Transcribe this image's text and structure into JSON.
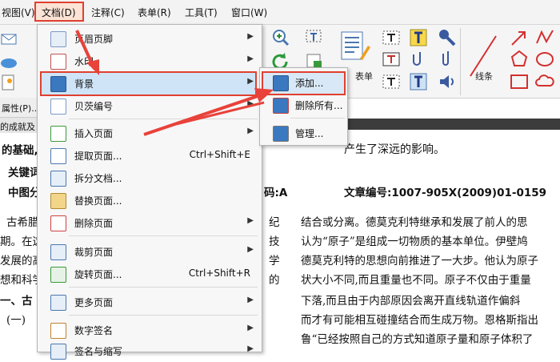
{
  "menubar": {
    "items": [
      {
        "label": "视图(V)"
      },
      {
        "label": "文档(D)"
      },
      {
        "label": "注释(C)"
      },
      {
        "label": "表单(R)"
      },
      {
        "label": "工具(T)"
      },
      {
        "label": "窗口(W)"
      }
    ]
  },
  "toolbar": {
    "props_label": "属性(P)...",
    "form_label": "表单",
    "line_label": "线条"
  },
  "document": {
    "lines": [
      "的基础,",
      "产生了深远的影响。",
      "关键词",
      "中图分",
      "码:A",
      "文章编号:1007-905X(2009)01-0159",
      "古希腊",
      "纪",
      "结合或分离。德莫克利特继承和发展了前人的思",
      "期。在这",
      "技",
      "认为“原子”是组成一切物质的基本单位。伊壁鸠",
      "发展的高",
      "学",
      "德莫克利特的思想向前推进了一大步。他认为原子",
      "想和科学",
      "的",
      "状大小不同,而且重量也不同。原子不仅由于重量",
      "一、古",
      "下落,而且由于内部原因会离开直线轨道作偏斜",
      "(一)",
      "而才有可能相互碰撞结合而生成万物。恩格斯指出",
      "鲁“已经按照自己的方式知道原子量和原子体积了",
      "的成就及"
    ]
  },
  "dropdown": {
    "items": [
      {
        "label": "页眉页脚",
        "shortcut": "",
        "submenu": true
      },
      {
        "label": "水印",
        "shortcut": "",
        "submenu": true
      },
      {
        "label": "背景",
        "shortcut": "",
        "submenu": true
      },
      {
        "label": "贝茨编号",
        "shortcut": "",
        "submenu": true
      },
      {
        "label": "插入页面",
        "shortcut": "",
        "submenu": true
      },
      {
        "label": "提取页面...",
        "shortcut": "Ctrl+Shift+E",
        "submenu": false
      },
      {
        "label": "拆分文档...",
        "shortcut": "",
        "submenu": false
      },
      {
        "label": "替换页面...",
        "shortcut": "",
        "submenu": false
      },
      {
        "label": "删除页面",
        "shortcut": "",
        "submenu": true
      },
      {
        "label": "裁剪页面",
        "shortcut": "",
        "submenu": true
      },
      {
        "label": "旋转页面...",
        "shortcut": "Ctrl+Shift+R",
        "submenu": false
      },
      {
        "label": "更多页面",
        "shortcut": "",
        "submenu": true
      },
      {
        "label": "数字签名",
        "shortcut": "",
        "submenu": true
      },
      {
        "label": "签名与缩写",
        "shortcut": "",
        "submenu": true
      }
    ]
  },
  "submenu": {
    "items": [
      {
        "label": "添加..."
      },
      {
        "label": "删除所有..."
      },
      {
        "label": "管理..."
      }
    ]
  },
  "colors": {
    "highlight_border": "#e0402f",
    "arrow": "#e8423a",
    "menu_highlight": "#cfe4f7"
  }
}
